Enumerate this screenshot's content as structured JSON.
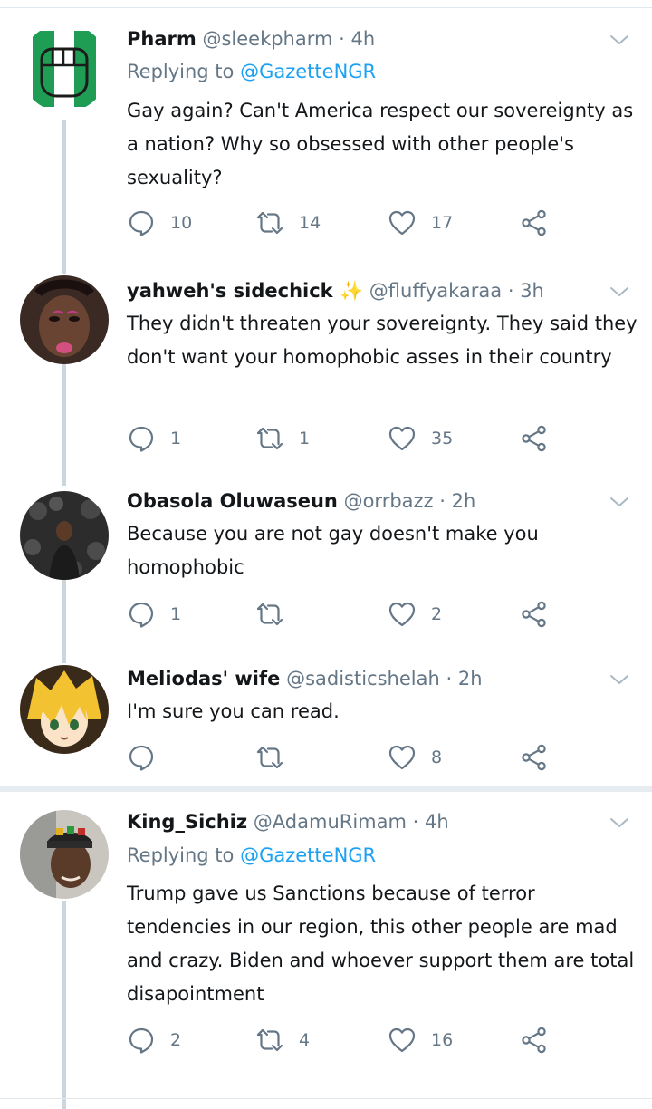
{
  "tweets": [
    {
      "name": "Pharm",
      "handle": "@sleekpharm",
      "dot": "·",
      "time": "4h",
      "replying_prefix": "Replying to",
      "replying_to": "@GazetteNGR",
      "text": "Gay again? Can't America respect our sovereignty as a nation? Why so obsessed with other people's sexuality?",
      "replies": "10",
      "retweets": "14",
      "likes": "17"
    },
    {
      "name": "yahweh's sidechick ✨",
      "handle": "@fluffyakaraa",
      "dot": "·",
      "time": "3h",
      "text": "They didn't threaten your sovereignty. They said they don't want your homophobic asses in their country",
      "replies": "1",
      "retweets": "1",
      "likes": "35"
    },
    {
      "name": "Obasola Oluwaseun",
      "handle": "@orrbazz",
      "dot": "·",
      "time": "2h",
      "text": "Because you are not gay doesn't make you homophobic",
      "replies": "1",
      "retweets": "",
      "likes": "2"
    },
    {
      "name": "Meliodas' wife",
      "handle": "@sadisticshelah",
      "dot": "·",
      "time": "2h",
      "text": "I'm sure you can read.",
      "replies": "",
      "retweets": "",
      "likes": "8"
    },
    {
      "name": "King_Sichiz",
      "handle": "@AdamuRimam",
      "dot": "·",
      "time": "4h",
      "replying_prefix": "Replying to",
      "replying_to": "@GazetteNGR",
      "text": "Trump gave us Sanctions because of terror tendencies in our region, this other people are mad and crazy. Biden and whoever support them are total disapointment",
      "replies": "2",
      "retweets": "4",
      "likes": "16"
    }
  ],
  "icons": {
    "reply": "reply-icon",
    "retweet": "retweet-icon",
    "like": "heart-icon",
    "share": "share-icon",
    "more": "chevron-down-icon"
  },
  "colors": {
    "text": "#14171a",
    "secondary": "#657786",
    "link": "#1da1f2",
    "thread_line": "#ccd6dd",
    "nigeria_green": "#008751"
  }
}
